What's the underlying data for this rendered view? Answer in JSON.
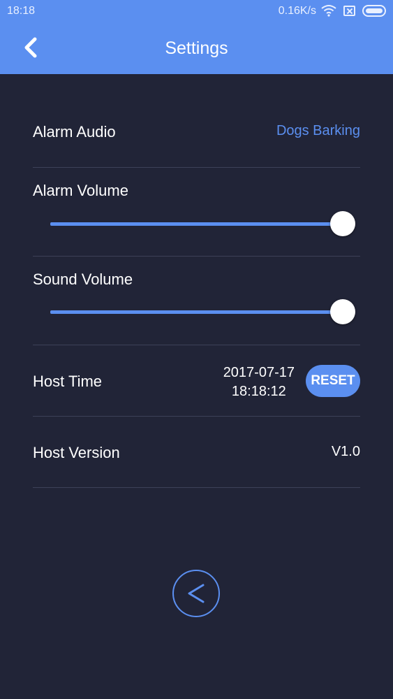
{
  "status_bar": {
    "time": "18:18",
    "speed": "0.16K/s",
    "icons": [
      "wifi-icon",
      "sim-x-icon",
      "battery-icon"
    ]
  },
  "header": {
    "title": "Settings",
    "back_icon": "chevron-left-icon"
  },
  "settings": {
    "alarm_audio": {
      "label": "Alarm Audio",
      "value": "Dogs Barking"
    },
    "alarm_volume": {
      "label": "Alarm Volume",
      "level": 1.0
    },
    "sound_volume": {
      "label": "Sound Volume",
      "level": 1.0
    },
    "host_time": {
      "label": "Host Time",
      "date": "2017-07-17",
      "time": "18:18:12",
      "reset_label": "RESET"
    },
    "host_version": {
      "label": "Host Version",
      "value": "V1.0"
    }
  },
  "footer": {
    "back_icon": "chevron-left-icon"
  },
  "colors": {
    "accent": "#5b8ff0",
    "background": "#212437",
    "divider": "#3d4158"
  }
}
